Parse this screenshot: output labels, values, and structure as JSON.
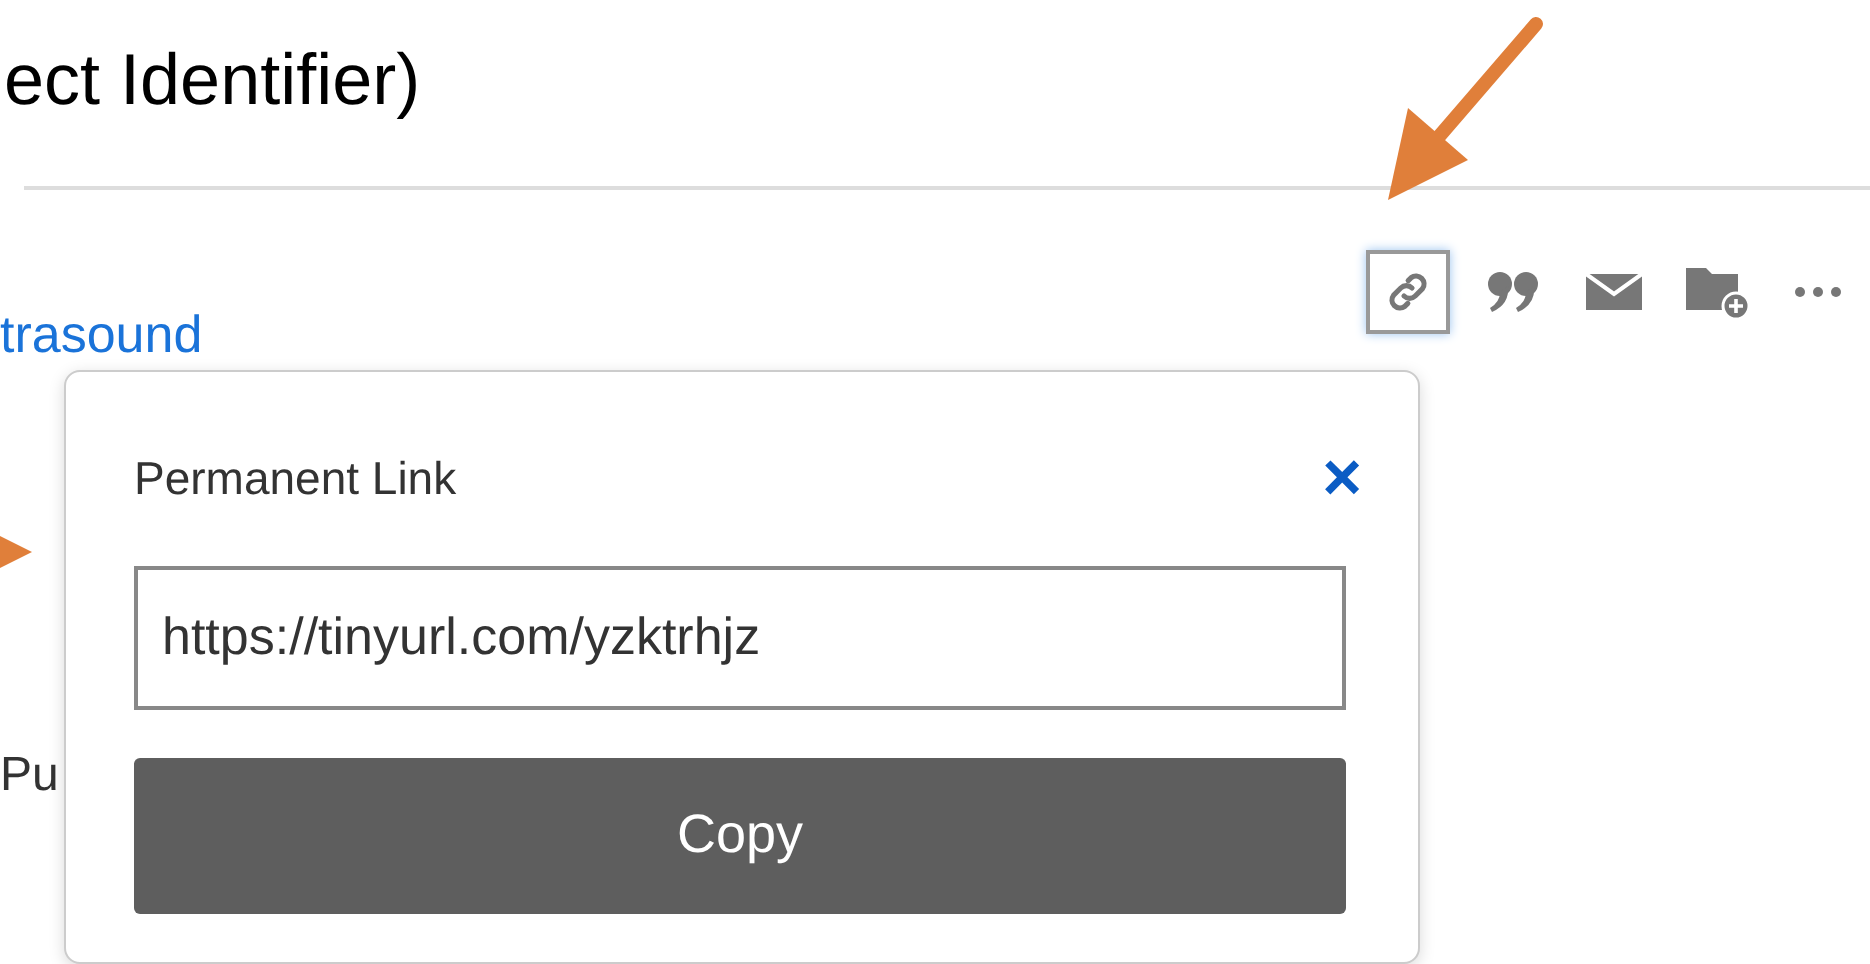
{
  "heading": "ect Identifier)",
  "toolbar": [
    {
      "kind": "link",
      "selected": true
    },
    {
      "kind": "quote",
      "selected": false
    },
    {
      "kind": "mail",
      "selected": false
    },
    {
      "kind": "folder",
      "selected": false
    },
    {
      "kind": "more",
      "selected": false
    }
  ],
  "result_title": "trasound",
  "side_text": "Pu",
  "popover": {
    "title": "Permanent Link",
    "close": "×",
    "url": "https://tinyurl.com/yzktrhjz",
    "button": "Copy"
  }
}
